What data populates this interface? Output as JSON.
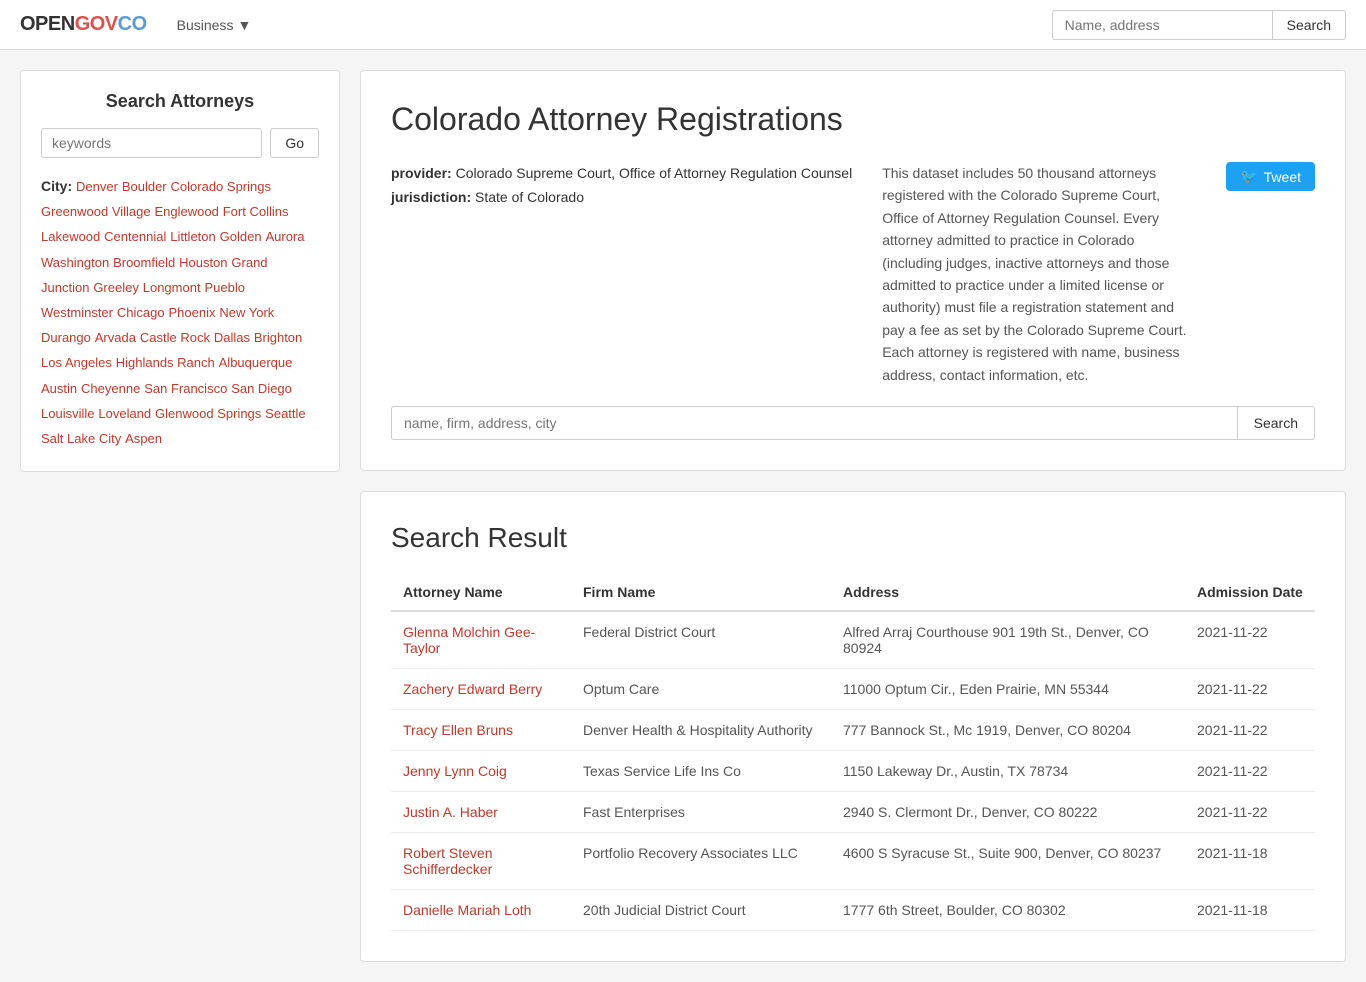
{
  "header": {
    "logo": {
      "open": "OPEN",
      "gov": "GOV",
      "co": "CO"
    },
    "nav": [
      {
        "label": "Business",
        "hasDropdown": true
      }
    ],
    "search": {
      "placeholder": "Name, address",
      "button": "Search"
    }
  },
  "sidebar": {
    "title": "Search Attorneys",
    "keyword_placeholder": "keywords",
    "go_button": "Go",
    "city_label": "City:",
    "cities": [
      "Denver",
      "Boulder",
      "Colorado Springs",
      "Greenwood Village",
      "Englewood",
      "Fort Collins",
      "Lakewood",
      "Centennial",
      "Littleton",
      "Golden",
      "Aurora",
      "Washington",
      "Broomfield",
      "Houston",
      "Grand Junction",
      "Greeley",
      "Longmont",
      "Pueblo",
      "Westminster",
      "Chicago",
      "Phoenix",
      "New York",
      "Durango",
      "Arvada",
      "Castle Rock",
      "Dallas",
      "Brighton",
      "Los Angeles",
      "Highlands Ranch",
      "Albuquerque",
      "Austin",
      "Cheyenne",
      "San Francisco",
      "San Diego",
      "Louisville",
      "Loveland",
      "Glenwood Springs",
      "Seattle",
      "Salt Lake City",
      "Aspen"
    ]
  },
  "main": {
    "page_title": "Colorado Attorney Registrations",
    "provider_label": "provider:",
    "provider_value": "Colorado Supreme Court, Office of Attorney Regulation Counsel",
    "jurisdiction_label": "jurisdiction:",
    "jurisdiction_value": "State of Colorado",
    "description": "This dataset includes 50 thousand attorneys registered with the Colorado Supreme Court, Office of Attorney Regulation Counsel. Every attorney admitted to practice in Colorado (including judges, inactive attorneys and those admitted to practice under a limited license or authority) must file a registration statement and pay a fee as set by the Colorado Supreme Court. Each attorney is registered with name, business address, contact information, etc.",
    "tweet_button": "Tweet",
    "search_placeholder": "name, firm, address, city",
    "search_button": "Search",
    "results_title": "Search Result",
    "table": {
      "columns": [
        "Attorney Name",
        "Firm Name",
        "Address",
        "Admission Date"
      ],
      "rows": [
        {
          "name": "Glenna Molchin Gee-Taylor",
          "firm": "Federal District Court",
          "address": "Alfred Arraj Courthouse 901 19th St., Denver, CO 80924",
          "date": "2021-11-22"
        },
        {
          "name": "Zachery Edward Berry",
          "firm": "Optum Care",
          "address": "11000 Optum Cir., Eden Prairie, MN 55344",
          "date": "2021-11-22"
        },
        {
          "name": "Tracy Ellen Bruns",
          "firm": "Denver Health & Hospitality Authority",
          "address": "777 Bannock St., Mc 1919, Denver, CO 80204",
          "date": "2021-11-22"
        },
        {
          "name": "Jenny Lynn Coig",
          "firm": "Texas Service Life Ins Co",
          "address": "1150 Lakeway Dr., Austin, TX 78734",
          "date": "2021-11-22"
        },
        {
          "name": "Justin A. Haber",
          "firm": "Fast Enterprises",
          "address": "2940 S. Clermont Dr., Denver, CO 80222",
          "date": "2021-11-22"
        },
        {
          "name": "Robert Steven Schifferdecker",
          "firm": "Portfolio Recovery Associates LLC",
          "address": "4600 S Syracuse St., Suite 900, Denver, CO 80237",
          "date": "2021-11-18"
        },
        {
          "name": "Danielle Mariah Loth",
          "firm": "20th Judicial District Court",
          "address": "1777 6th Street, Boulder, CO 80302",
          "date": "2021-11-18"
        }
      ]
    }
  }
}
